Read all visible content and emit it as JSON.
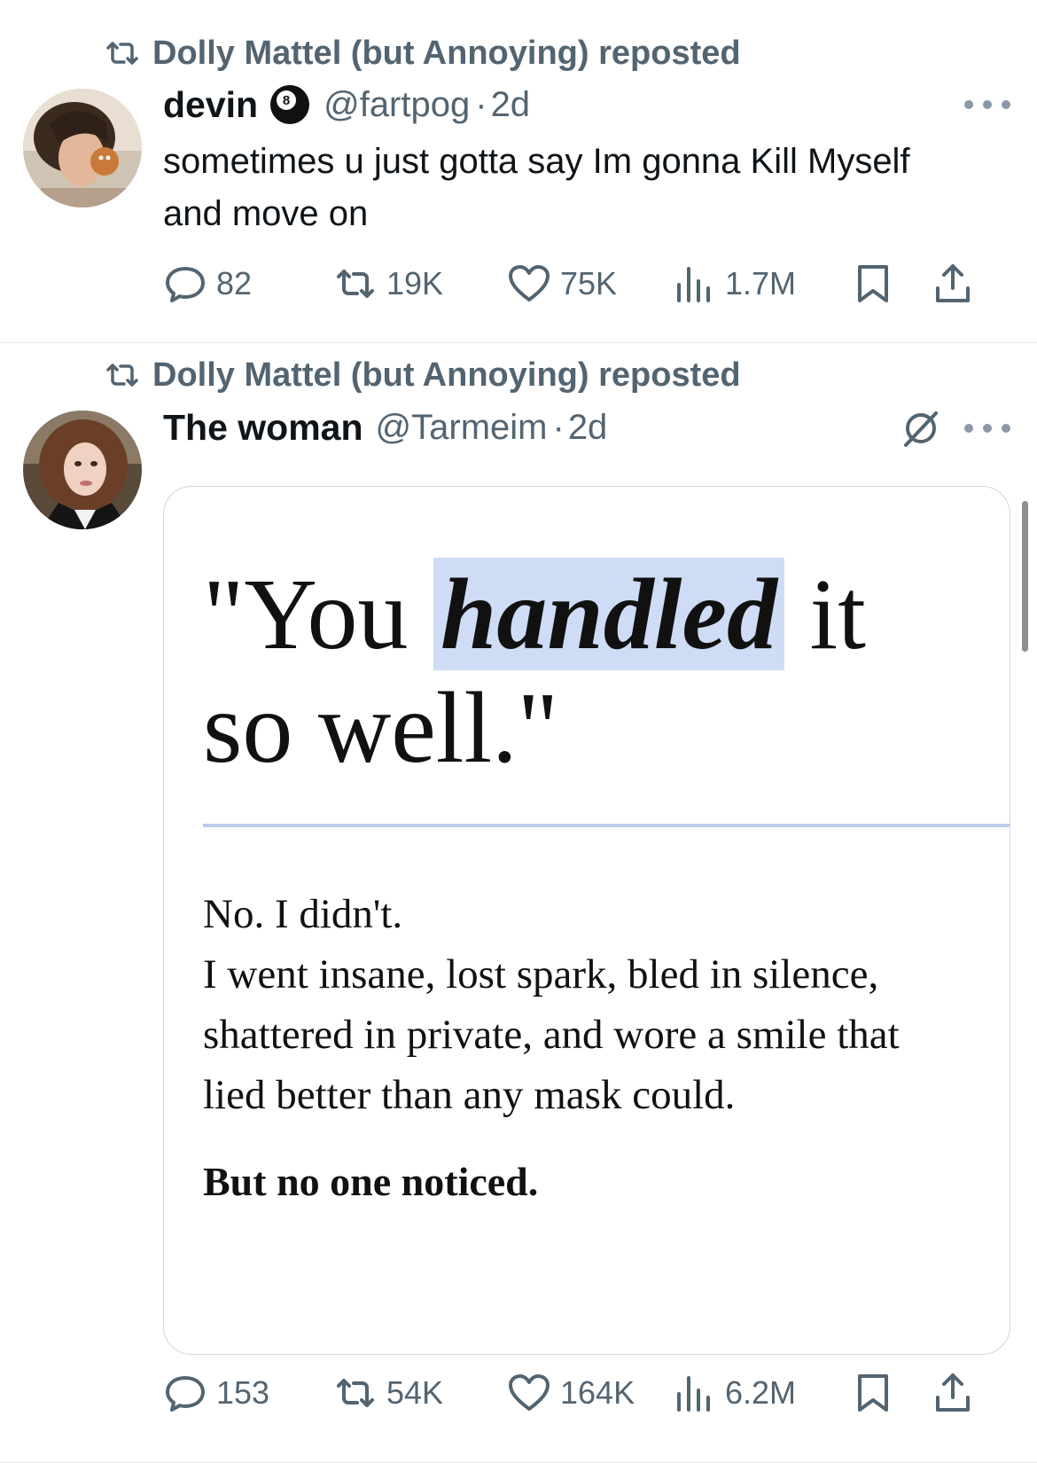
{
  "tweets": [
    {
      "repost_label": "Dolly Mattel (but Annoying) reposted",
      "display_name": "devin",
      "handle": "@fartpog",
      "time": "2d",
      "badge_icon": "8-ball-icon",
      "text_lines": [
        "sometimes u just gotta say Im gonna Kill Myself",
        "and move on"
      ],
      "stats": {
        "replies": "82",
        "reposts": "19K",
        "likes": "75K",
        "views": "1.7M"
      }
    },
    {
      "repost_label": "Dolly Mattel (but Annoying) reposted",
      "display_name": "The woman",
      "handle": "@Tarmeim",
      "time": "2d",
      "media": {
        "quote_open": "\"You ",
        "quote_highlight": "handled",
        "quote_after": " it",
        "quote_line2": "so well.\"",
        "body_lines": [
          "No. I didn't.",
          "I went insane, lost spark, bled in silence,",
          "shattered in private, and wore a smile that",
          "lied better than any mask could."
        ],
        "closing": "But no one noticed.",
        "highlight_color": "#cfdcf6"
      },
      "stats": {
        "replies": "153",
        "reposts": "54K",
        "likes": "164K",
        "views": "6.2M"
      }
    }
  ],
  "colors": {
    "secondary_text": "#536471",
    "primary_text": "#0f1419",
    "divider": "#e6e9ec"
  }
}
